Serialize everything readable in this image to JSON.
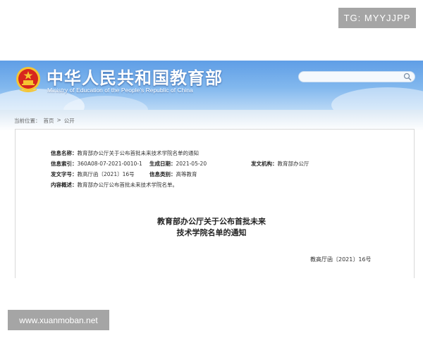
{
  "badge": {
    "text": "TG: MYYJJPP"
  },
  "site": {
    "title_cn": "中华人民共和国教育部",
    "title_en": "Ministry of Education of the People's Republic of China"
  },
  "search": {
    "placeholder": ""
  },
  "breadcrumb": {
    "current_label": "当前位置：",
    "home": "首页",
    "separator": ">",
    "section": "公开"
  },
  "meta": {
    "name_label": "信息名称：",
    "name_value": "教育部办公厅关于公布首批未来技术学院名单的通知",
    "index_label": "信息索引：",
    "index_value": "360A08-07-2021-0010-1",
    "date_label": "生成日期：",
    "date_value": "2021-05-20",
    "issuer_label": "发文机构：",
    "issuer_value": "教育部办公厅",
    "docno_label": "发文字号：",
    "docno_value": "教高厅函〔2021〕16号",
    "category_label": "信息类别：",
    "category_value": "高等教育",
    "summary_label": "内容概述：",
    "summary_value": "教育部办公厅公布首批未来技术学院名单。"
  },
  "document": {
    "title_line1": "教育部办公厅关于公布首批未来",
    "title_line2": "技术学院名单的通知",
    "number": "教高厅函〔2021〕16号"
  },
  "watermark": {
    "text": "www.xuanmoban.net"
  },
  "colors": {
    "banner_top": "#5f9ee6",
    "banner_bottom": "#b9d8f6",
    "badge_bg": "#a5a5a5",
    "emblem_red": "#d7261e",
    "emblem_gold": "#f5c531"
  }
}
